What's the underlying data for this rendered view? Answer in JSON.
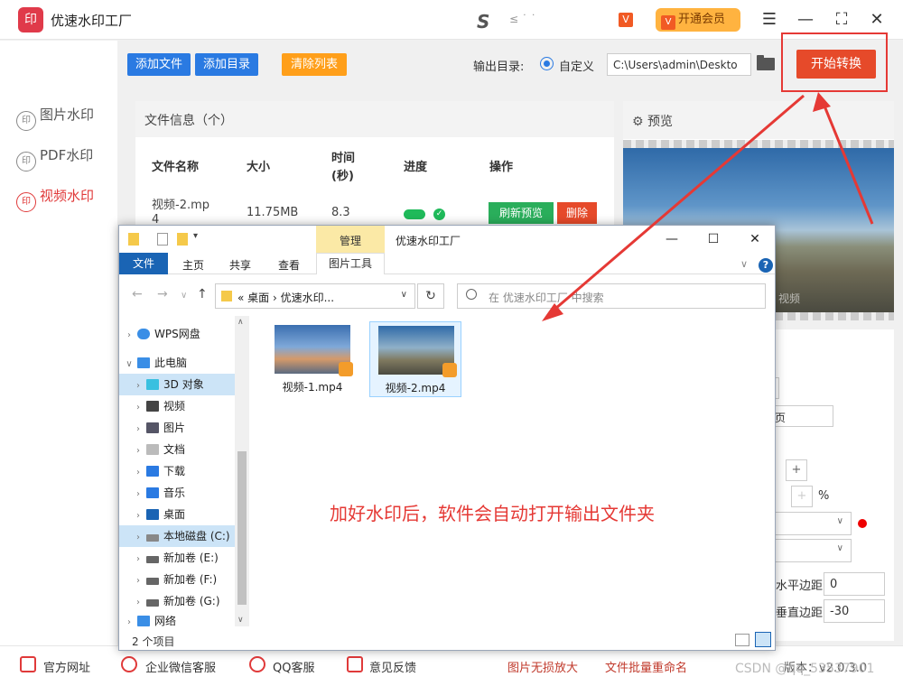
{
  "app": {
    "title": "优速水印工厂",
    "logo_text": "印",
    "user_logo": "S",
    "user_name": "≤ ˙ ˙",
    "vip_label": "开通会员",
    "vip_badge": "V"
  },
  "sidebar": {
    "items": [
      {
        "label": "图片水印",
        "icon": "印"
      },
      {
        "label": "PDF水印",
        "icon": "印"
      },
      {
        "label": "视频水印",
        "icon": "印"
      }
    ]
  },
  "toolbar": {
    "add_file": "添加文件",
    "add_dir": "添加目录",
    "clear_list": "清除列表",
    "output_label": "输出目录:",
    "radio_label": "自定义",
    "path_value": "C:\\Users\\admin\\Deskto",
    "start": "开始转换"
  },
  "file_panel": {
    "title": "文件信息（个）",
    "headers": [
      "文件名称",
      "大小",
      "时间",
      "(秒)",
      "进度",
      "操作"
    ],
    "row": {
      "name_line1": "视频-2.mp",
      "name_line2": "4",
      "size": "11.75MB",
      "time": "8.3",
      "progress": 1.0,
      "refresh": "刷新预览",
      "delete": "删除"
    }
  },
  "preview": {
    "title": "预览",
    "watermark": "视频"
  },
  "settings": {
    "text_field_partial": "页",
    "percent": "%",
    "h_margin_label": "水平边距",
    "h_margin_value": "0",
    "v_margin_label": "垂直边距",
    "v_margin_value": "-30",
    "plus": "+"
  },
  "statusbar": {
    "items": [
      "官方网址",
      "企业微信客服",
      "QQ客服",
      "意见反馈"
    ],
    "links": [
      "图片无损放大",
      "文件批量重命名"
    ],
    "version": "版本：v2.0.3.0",
    "csdn": "CSDN @qq_53537901"
  },
  "explorer": {
    "manage_tab": "管理",
    "window_title": "优速水印工厂",
    "tabs": [
      "文件",
      "主页",
      "共享",
      "查看"
    ],
    "tools_tab": "图片工具",
    "address": "«  桌面  ›  优速水印...",
    "search_placeholder": "在 优速水印工厂 中搜索",
    "tree": [
      {
        "label": "WPS网盘",
        "icon_color": "#3a8ee6"
      },
      {
        "label": "此电脑",
        "icon_color": "#3a8ee6"
      },
      {
        "label": "3D 对象",
        "icon_color": "#39c0e0"
      },
      {
        "label": "视频",
        "icon_color": "#444"
      },
      {
        "label": "图片",
        "icon_color": "#556"
      },
      {
        "label": "文档",
        "icon_color": "#bbb"
      },
      {
        "label": "下载",
        "icon_color": "#2a7ae2"
      },
      {
        "label": "音乐",
        "icon_color": "#2a7ae2"
      },
      {
        "label": "桌面",
        "icon_color": "#1a64b4"
      },
      {
        "label": "本地磁盘 (C:)",
        "icon_color": "#888"
      },
      {
        "label": "新加卷 (E:)",
        "icon_color": "#666"
      },
      {
        "label": "新加卷 (F:)",
        "icon_color": "#666"
      },
      {
        "label": "新加卷 (G:)",
        "icon_color": "#666"
      },
      {
        "label": "网络",
        "icon_color": "#3a8ee6"
      }
    ],
    "files": [
      {
        "name": "视频-1.mp4"
      },
      {
        "name": "视频-2.mp4"
      }
    ],
    "status": "2 个项目"
  },
  "annotation": "加好水印后，软件会自动打开输出文件夹",
  "colors": {
    "brand_red": "#e03a4a",
    "accent_blue": "#2a7ae2",
    "start_red": "#e64a2a",
    "clear_orange": "#ff9f1a",
    "ok_green": "#2aae5b",
    "annotation_red": "#e53935"
  }
}
